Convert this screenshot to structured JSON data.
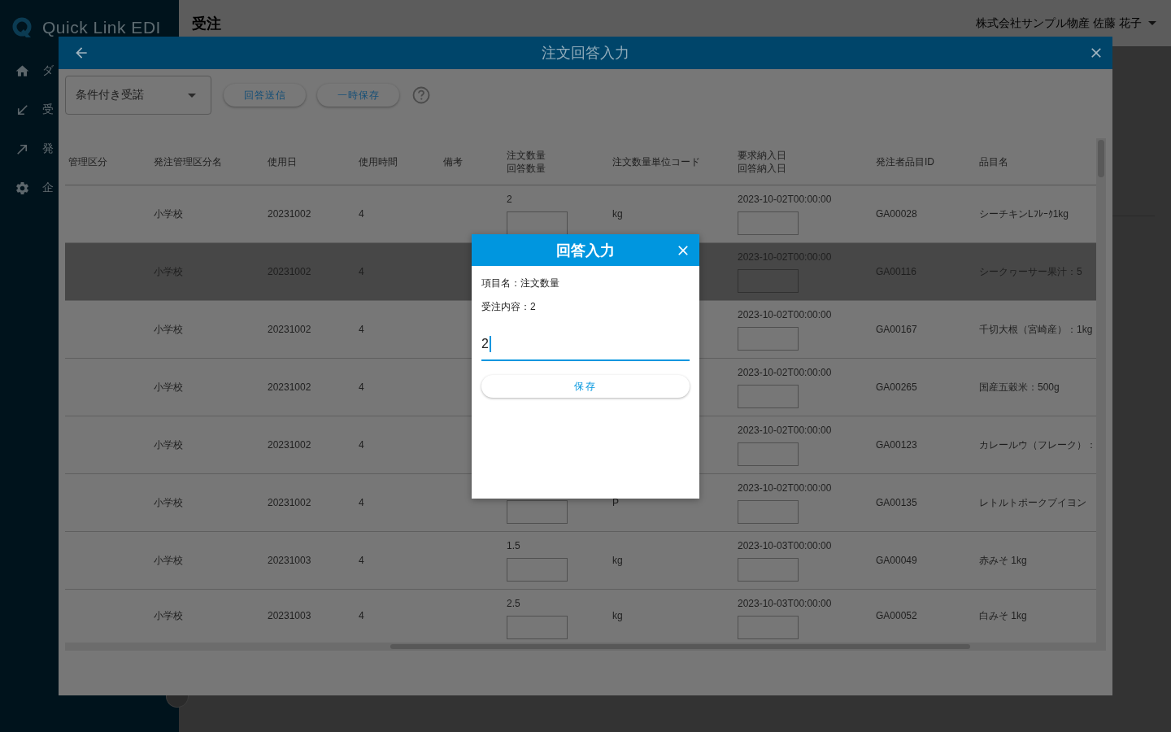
{
  "sidebar": {
    "logo": "Quick Link EDI",
    "items": [
      "ダ",
      "受",
      "発",
      "企"
    ]
  },
  "header": {
    "title": "受注",
    "account": "株式会社サンプル物産 佐藤 花子"
  },
  "order_answer_modal": {
    "title": "注文回答入力",
    "answer_type": "条件付き受諾",
    "buttons": [
      "回答送信",
      "一時保存"
    ],
    "table": {
      "columns": [
        {
          "label": "管理区分"
        },
        {
          "label": "発注管理区分名"
        },
        {
          "label": "使用日"
        },
        {
          "label": "使用時間"
        },
        {
          "label": "備考"
        },
        {
          "label": "注文数量",
          "sublabel": "回答数量"
        },
        {
          "label": "注文数量単位コード"
        },
        {
          "label": "要求納入日",
          "sublabel": "回答納入日"
        },
        {
          "label": "発注者品目ID"
        },
        {
          "label": "品目名"
        }
      ],
      "rows": [
        {
          "selected": false,
          "division_name": "小学校",
          "use_date": "20231002",
          "use_time": "4",
          "order_quantity": "2",
          "answer_quantity_input": true,
          "unit_code": "kg",
          "requested_date": "2023-10-02T00:00:00",
          "item_id": "GA00028",
          "item_name": "シーチキンLﾌﾚｰｸ1kg"
        },
        {
          "selected": true,
          "division_name": "小学校",
          "use_date": "20231002",
          "use_time": "4",
          "requested_date": "2023-10-02T00:00:00",
          "item_id": "GA00116",
          "item_name": "シークヮーサー果汁：5"
        },
        {
          "selected": false,
          "division_name": "小学校",
          "use_date": "20231002",
          "use_time": "4",
          "requested_date": "2023-10-02T00:00:00",
          "item_id": "GA00167",
          "item_name": "千切大根（宮崎産）：1kg"
        },
        {
          "selected": false,
          "division_name": "小学校",
          "use_date": "20231002",
          "use_time": "4",
          "requested_date": "2023-10-02T00:00:00",
          "item_id": "GA00265",
          "item_name": "国産五穀米：500g"
        },
        {
          "selected": false,
          "division_name": "小学校",
          "use_date": "20231002",
          "use_time": "4",
          "requested_date": "2023-10-02T00:00:00",
          "item_id": "GA00123",
          "item_name": "カレールウ（フレーク）："
        },
        {
          "selected": false,
          "division_name": "小学校",
          "use_date": "20231002",
          "use_time": "4",
          "answer_quantity_input": true,
          "unit_code": "P",
          "requested_date": "2023-10-02T00:00:00",
          "item_id": "GA00135",
          "item_name": "レトルトポークブイヨン"
        },
        {
          "selected": false,
          "division_name": "小学校",
          "use_date": "20231003",
          "use_time": "4",
          "order_quantity": "1.5",
          "answer_quantity_input": true,
          "unit_code": "kg",
          "requested_date": "2023-10-03T00:00:00",
          "item_id": "GA00049",
          "item_name": "赤みそ 1kg"
        },
        {
          "selected": false,
          "division_name": "小学校",
          "use_date": "20231003",
          "use_time": "4",
          "order_quantity": "2.5",
          "answer_quantity_input": true,
          "unit_code": "kg",
          "requested_date": "2023-10-03T00:00:00",
          "item_id": "GA00052",
          "item_name": "白みそ 1kg"
        }
      ]
    }
  },
  "answer_dialog": {
    "title": "回答入力",
    "item_name": "項目名：注文数量",
    "order_content": "受注内容：2",
    "value": "2",
    "save_button": "保存"
  }
}
